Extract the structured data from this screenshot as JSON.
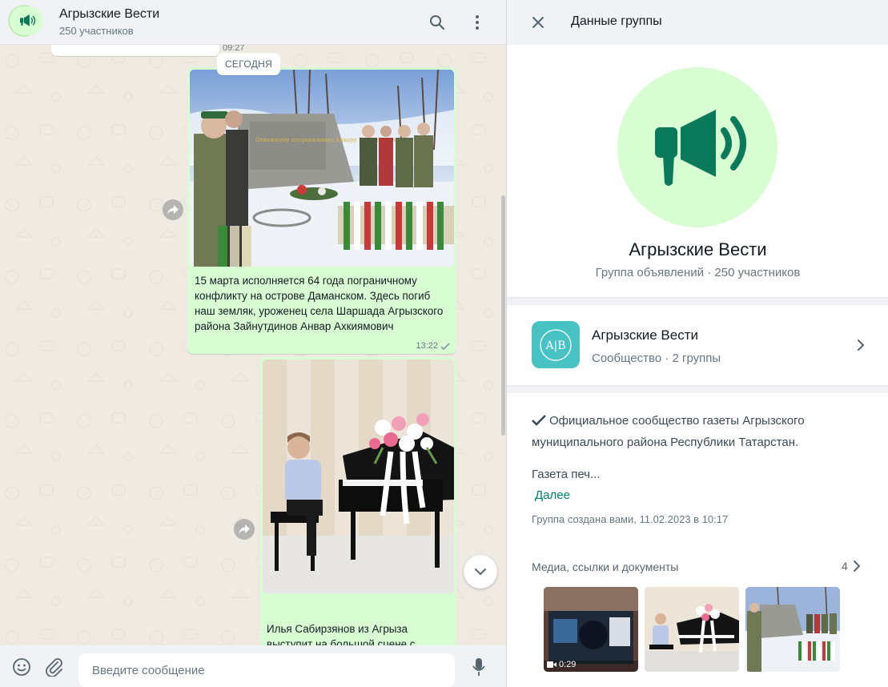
{
  "chat": {
    "title": "Агрызские Вести",
    "subtitle": "250 участников",
    "previous_time": "09:27",
    "date_chip": "СЕГОДНЯ",
    "messages": [
      {
        "caption": "15 марта исполняется 64 года пограничному конфликту на острове Даманском. Здесь погиб наш земляк, уроженец села Шаршада Агрызского района Зайнутдинов Анвар Ахкиямович",
        "time": "13:22",
        "photo_sign": "Отважному пограничнику Анвару Зайнутдинову"
      },
      {
        "caption": "Илья Сабирзянов из Агрыза выступит на большой сцене с"
      }
    ],
    "composer": {
      "placeholder": "Введите сообщение"
    }
  },
  "info": {
    "header_title": "Данные группы",
    "group_name": "Агрызские Вести",
    "group_subtitle": "Группа объявлений · 250 участников",
    "community": {
      "name": "Агрызские Вести",
      "subtitle": "Сообщество · 2 группы",
      "logo_text": "A|B"
    },
    "description": {
      "line1": "Официальное сообщество газеты Агрызского муниципального района Республики Татарстан.",
      "truncated": "Газета печ...",
      "more_link": "Далее"
    },
    "created": "Группа создана вами, 11.02.2023 в 10:17",
    "media": {
      "label": "Медиа, ссылки и документы",
      "count": "4",
      "video_duration": "0:29"
    }
  },
  "colors": {
    "accent": "#008069",
    "bubble_out": "#d9fdd3",
    "avatar_bg": "#d9fdd3",
    "megaphone": "#0b7a5a",
    "community_logo": "#49c2c4"
  }
}
